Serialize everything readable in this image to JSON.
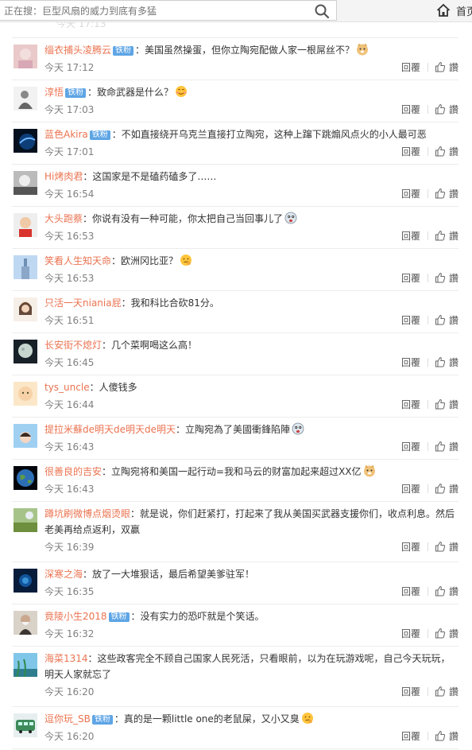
{
  "search": {
    "placeholder": "正在搜：巨型风扇的威力到底有多猛"
  },
  "nav": {
    "home_label": "首页"
  },
  "action_labels": {
    "reply": "回覆",
    "like": "讚"
  },
  "badge_label": "铁粉",
  "comments": [
    {
      "user": "缁衣捕头凌腾云",
      "badge": true,
      "text": "：美国虽然操蛋，但你立陶宛配做人家一根屌丝不？",
      "emoji": "doge",
      "time": "今天 17:12",
      "avatar": "pink-portrait"
    },
    {
      "user": "淳悟",
      "badge": true,
      "text": "：致命武器是什么？",
      "emoji": "smile",
      "time": "今天 17:03",
      "avatar": "gray-figure"
    },
    {
      "user": "蓝色Akira",
      "badge": true,
      "text": "：不如直接绕开乌克兰直接打立陶宛，这种上蹿下跳煽风点火的小人最可恶",
      "emoji": "",
      "time": "今天 17:01",
      "avatar": "planet"
    },
    {
      "user": "Hi烤肉君",
      "badge": false,
      "text": "：这国家是不是磕药磕多了……",
      "emoji": "",
      "time": "今天 16:54",
      "avatar": "bw-portrait"
    },
    {
      "user": "大头跑蔡",
      "badge": false,
      "text": "：你说有没有一种可能，你太把自己当回事儿了",
      "emoji": "dizzy",
      "time": "今天 16:53",
      "avatar": "red-child"
    },
    {
      "user": "笑看人生知天命",
      "badge": false,
      "text": "：欧洲冈比亚？",
      "emoji": "thinking",
      "time": "今天 16:53",
      "avatar": "tower"
    },
    {
      "user": "只活一天niania屁",
      "badge": false,
      "text": "：我和科比合砍81分。",
      "emoji": "",
      "time": "今天 16:51",
      "avatar": "girl"
    },
    {
      "user": "长安街不熄灯",
      "badge": false,
      "text": "：几个菜啊喝这么高！",
      "emoji": "",
      "time": "今天 16:45",
      "avatar": "moon"
    },
    {
      "user": "tys_uncle",
      "badge": false,
      "text": "：人傻钱多",
      "emoji": "",
      "time": "今天 16:44",
      "avatar": "baby"
    },
    {
      "user": "提拉米蘇de明天de明天de明天",
      "badge": false,
      "text": "：立陶宛為了美國衝鋒陷陣",
      "emoji": "dizzy",
      "time": "今天 16:43",
      "avatar": "sky-girl"
    },
    {
      "user": "很善良的吉安",
      "badge": false,
      "text": "：立陶宛将和美国一起行动=我和马云的财富加起来超过XX亿",
      "emoji": "doge",
      "time": "今天 16:43",
      "avatar": "earth"
    },
    {
      "user": "蹲坑刷微博点烟烫眼",
      "badge": false,
      "text": "：就是说，你们赶紧打，打起来了我从美国买武器支援你们，收点利息。然后老美再给点返利，双赢",
      "emoji": "",
      "time": "今天 16:39",
      "avatar": "field"
    },
    {
      "user": "深寒之海",
      "badge": false,
      "text": "：放了一大堆狠话，最后希望美爹驻军！",
      "emoji": "",
      "time": "今天 16:35",
      "avatar": "ocean"
    },
    {
      "user": "竟陵小生2018",
      "badge": true,
      "text": "：没有实力的恐吓就是个笑话。",
      "emoji": "",
      "time": "今天 16:32",
      "avatar": "old-man"
    },
    {
      "user": "海菜1314",
      "badge": false,
      "text": "：这些政客完全不顾自己国家人民死活，只看眼前，以为在玩游戏呢，自己今天玩玩，明天人家就忘了",
      "emoji": "",
      "time": "今天 16:20",
      "avatar": "sea-grass"
    },
    {
      "user": "逗你玩_SB",
      "badge": true,
      "text": "：真的是一颗little one的老鼠屎，又小又臭",
      "emoji": "thinking",
      "time": "今天 16:20",
      "avatar": "bus"
    }
  ],
  "colors": {
    "username": "#eb7350",
    "badge": "#5ea5e5",
    "time": "#808080"
  }
}
